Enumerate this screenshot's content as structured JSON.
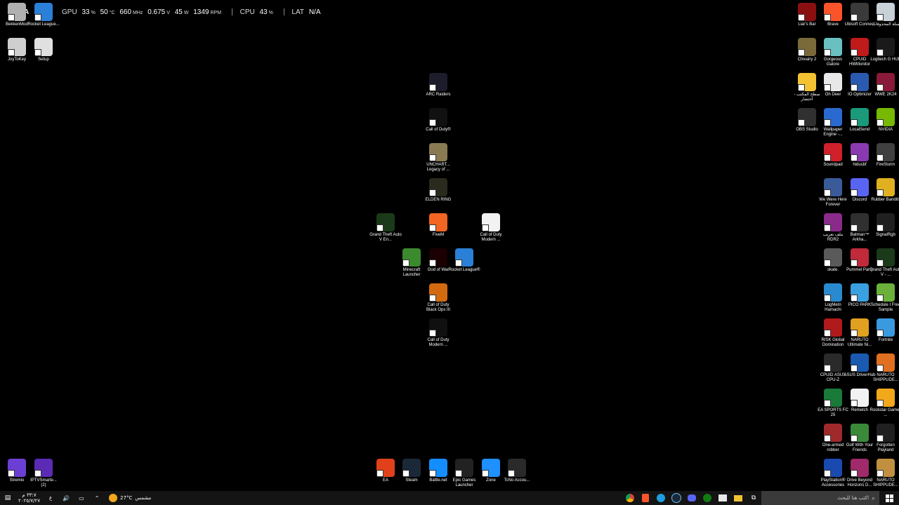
{
  "osd": {
    "gpu_label": "GPU",
    "gpu_usage": "33",
    "gpu_usage_unit": "%",
    "gpu_temp": "50",
    "gpu_temp_unit": "°C",
    "gpu_clock": "660",
    "gpu_clock_unit": "MHz",
    "gpu_voltage": "0.675",
    "gpu_voltage_unit": "V",
    "gpu_power": "45",
    "gpu_power_unit": "W",
    "gpu_fan": "1349",
    "gpu_fan_unit": "RPM",
    "cpu_label": "CPU",
    "cpu_usage": "43",
    "cpu_usage_unit": "%",
    "lat_label": "LAT",
    "lat_value": "N/A",
    "na_overlay": "N/A"
  },
  "left_icons": [
    {
      "label": "BekkenMod",
      "icon": "bekken-icon",
      "color": "#b0b0b0"
    },
    {
      "label": "Rocket League...",
      "icon": "rocket-league-icon",
      "color": "#2a7fd6"
    },
    {
      "label": "JoyToKey",
      "icon": "joytokey-icon",
      "color": "#cfcfcf"
    },
    {
      "label": "Setup",
      "icon": "setup-icon",
      "color": "#e0e0e0"
    },
    {
      "label": "Stremio",
      "icon": "stremio-icon",
      "color": "#6b3fd4"
    },
    {
      "label": "IPTVSmarte... (2)",
      "icon": "iptv-icon",
      "color": "#5b2bb5"
    }
  ],
  "center_icons": [
    {
      "label": "ARC Raiders",
      "icon": "arc-raiders-icon",
      "color": "#1c1c2a"
    },
    {
      "label": "Call of Duty®",
      "icon": "call-of-duty-icon",
      "color": "#111111"
    },
    {
      "label": "UNCHART... Legacy of ...",
      "icon": "uncharted-icon",
      "color": "#8a7a52"
    },
    {
      "label": "ELDEN RING",
      "icon": "elden-ring-icon",
      "color": "#2a2a1e"
    },
    {
      "label": "Grand Theft Auto V En...",
      "icon": "gta-v-icon",
      "color": "#1a3a1a"
    },
    {
      "label": "FiveM",
      "icon": "fivem-icon",
      "color": "#f26522"
    },
    {
      "label": "Call of Duty Modern ...",
      "icon": "blank-file-icon",
      "color": "#f2f2f2"
    },
    {
      "label": "Minecraft Launcher",
      "icon": "minecraft-icon",
      "color": "#3c8a2e"
    },
    {
      "label": "God of War",
      "icon": "god-of-war-icon",
      "color": "#1a0000"
    },
    {
      "label": "Rocket League®",
      "icon": "rocket-league-icon",
      "color": "#2a7fd6"
    },
    {
      "label": "Call of Duty Black Ops III",
      "icon": "black-ops-icon",
      "color": "#d46a10"
    },
    {
      "label": "Call of Duty Modern ...",
      "icon": "modern-warfare-icon",
      "color": "#101010"
    },
    {
      "label": "EA",
      "icon": "ea-icon",
      "color": "#e0411a"
    },
    {
      "label": "Steam",
      "icon": "steam-icon",
      "color": "#1b2838"
    },
    {
      "label": "Battle.net",
      "icon": "battlenet-icon",
      "color": "#148eff"
    },
    {
      "label": "Epic Games Launcher",
      "icon": "epic-games-icon",
      "color": "#222222"
    },
    {
      "label": "Zone",
      "icon": "zone-icon",
      "color": "#1e90ff"
    },
    {
      "label": "TcNo Accou...",
      "icon": "tcno-icon",
      "color": "#2a2a2a"
    }
  ],
  "right_icons": [
    {
      "label": "Liar's Bar",
      "icon": "liars-bar-icon",
      "color": "#8a1010"
    },
    {
      "label": "Brave",
      "icon": "brave-icon",
      "color": "#fb542b"
    },
    {
      "label": "Ubisoft Connect",
      "icon": "ubisoft-icon",
      "color": "#3a3a3a"
    },
    {
      "label": "سلة المحذوفات",
      "icon": "recycle-bin-icon",
      "color": "#c8d0d8"
    },
    {
      "label": "Chivalry 2",
      "icon": "chivalry-icon",
      "color": "#7a6a3a"
    },
    {
      "label": "Gorgeous Galore",
      "icon": "gorgeous-galore-icon",
      "color": "#6ac0c0"
    },
    {
      "label": "CPUID HWMonitor",
      "icon": "hwmonitor-icon",
      "color": "#c01a1a"
    },
    {
      "label": "Logitech G HUB",
      "icon": "logitech-icon",
      "color": "#1a1a1a"
    },
    {
      "label": "سطح المكتب - اختصار",
      "icon": "folder-icon",
      "color": "#f2c233"
    },
    {
      "label": "Oh Deer",
      "icon": "oh-deer-icon",
      "color": "#e8e8e8"
    },
    {
      "label": "IO Optimizer",
      "icon": "io-optimizer-icon",
      "color": "#2a5ab0"
    },
    {
      "label": "WWE 2K24",
      "icon": "wwe-icon",
      "color": "#8a1a3a"
    },
    {
      "label": "OBS Studio",
      "icon": "obs-icon",
      "color": "#303030"
    },
    {
      "label": "Wallpaper Engine -...",
      "icon": "wallpaper-engine-icon",
      "color": "#2a6ad0"
    },
    {
      "label": "LocalSend",
      "icon": "localsend-icon",
      "color": "#1a9a7a"
    },
    {
      "label": "NVIDIA",
      "icon": "nvidia-icon",
      "color": "#76b900"
    },
    {
      "label": "Soundpad",
      "icon": "soundpad-icon",
      "color": "#d0202a"
    },
    {
      "label": "hidusbf",
      "icon": "hidusbf-icon",
      "color": "#8a3ab0"
    },
    {
      "label": "FireStorm",
      "icon": "firestorm-icon",
      "color": "#404040"
    },
    {
      "label": "We Were Here Forever",
      "icon": "we-were-here-icon",
      "color": "#3a5a9a"
    },
    {
      "label": "Discord",
      "icon": "discord-icon",
      "color": "#5865f2"
    },
    {
      "label": "Rubber Bandits",
      "icon": "rubber-bandits-icon",
      "color": "#e0b020"
    },
    {
      "label": "ملف تعريب RDR2",
      "icon": "winrar-icon",
      "color": "#8a2a8a"
    },
    {
      "label": "Batman™ Arkha...",
      "icon": "batman-icon",
      "color": "#303030"
    },
    {
      "label": "SignalRgb",
      "icon": "signalrgb-icon",
      "color": "#202020"
    },
    {
      "label": "skate.",
      "icon": "skate-icon",
      "color": "#5a5a5a"
    },
    {
      "label": "Pummel Party",
      "icon": "pummel-party-icon",
      "color": "#c02a3a"
    },
    {
      "label": "Grand Theft Auto V - ...",
      "icon": "gta-v-icon",
      "color": "#1a3a1a"
    },
    {
      "label": "LogMeIn Hamachi",
      "icon": "hamachi-icon",
      "color": "#2a8ad0"
    },
    {
      "label": "PICO PARK",
      "icon": "pico-park-icon",
      "color": "#3aa0e0"
    },
    {
      "label": "Schedule I Free Sample",
      "icon": "schedule-icon",
      "color": "#6ab03a"
    },
    {
      "label": "RISK Global Domination",
      "icon": "risk-icon",
      "color": "#b01a1a"
    },
    {
      "label": "NARUTO Ultimate Ni...",
      "icon": "naruto-icon",
      "color": "#e0a020"
    },
    {
      "label": "Fortnite",
      "icon": "fortnite-icon",
      "color": "#3a9ae0"
    },
    {
      "label": "CPUID ASUS CPU-Z",
      "icon": "cpuz-icon",
      "color": "#2a2a2a"
    },
    {
      "label": "ASUS DriverHub",
      "icon": "asus-icon",
      "color": "#1a5ab0"
    },
    {
      "label": "NARUTO SHIPPUDE...",
      "icon": "naruto-icon",
      "color": "#e07020"
    },
    {
      "label": "EA SPORTS FC 25",
      "icon": "ea-fc-icon",
      "color": "#1a7a3a"
    },
    {
      "label": "Remetch",
      "icon": "blank-file-icon",
      "color": "#f2f2f2"
    },
    {
      "label": "Rockstar Games ...",
      "icon": "rockstar-icon",
      "color": "#f2a81a"
    },
    {
      "label": "One-armed robber",
      "icon": "one-armed-robber-icon",
      "color": "#a02a2a"
    },
    {
      "label": "Golf With Your Friends",
      "icon": "golf-icon",
      "color": "#3a8a3a"
    },
    {
      "label": "Forgotten Playland",
      "icon": "epic-games-icon",
      "color": "#202020"
    },
    {
      "label": "PlayStation® Accessories",
      "icon": "playstation-icon",
      "color": "#1a4ab0"
    },
    {
      "label": "Drive Beyond Horizons D...",
      "icon": "drive-beyond-icon",
      "color": "#a02a6a"
    },
    {
      "label": "NARUTO SHIPPUDE...",
      "icon": "naruto-icon",
      "color": "#c09040"
    }
  ],
  "taskbar": {
    "time": "٣٣:٧ م",
    "date": "٢٠٢٥/٧/٢٧",
    "weather_temp": "27°C",
    "weather_desc": "مشمس",
    "search_placeholder": "اكتب هنا للبحث"
  }
}
